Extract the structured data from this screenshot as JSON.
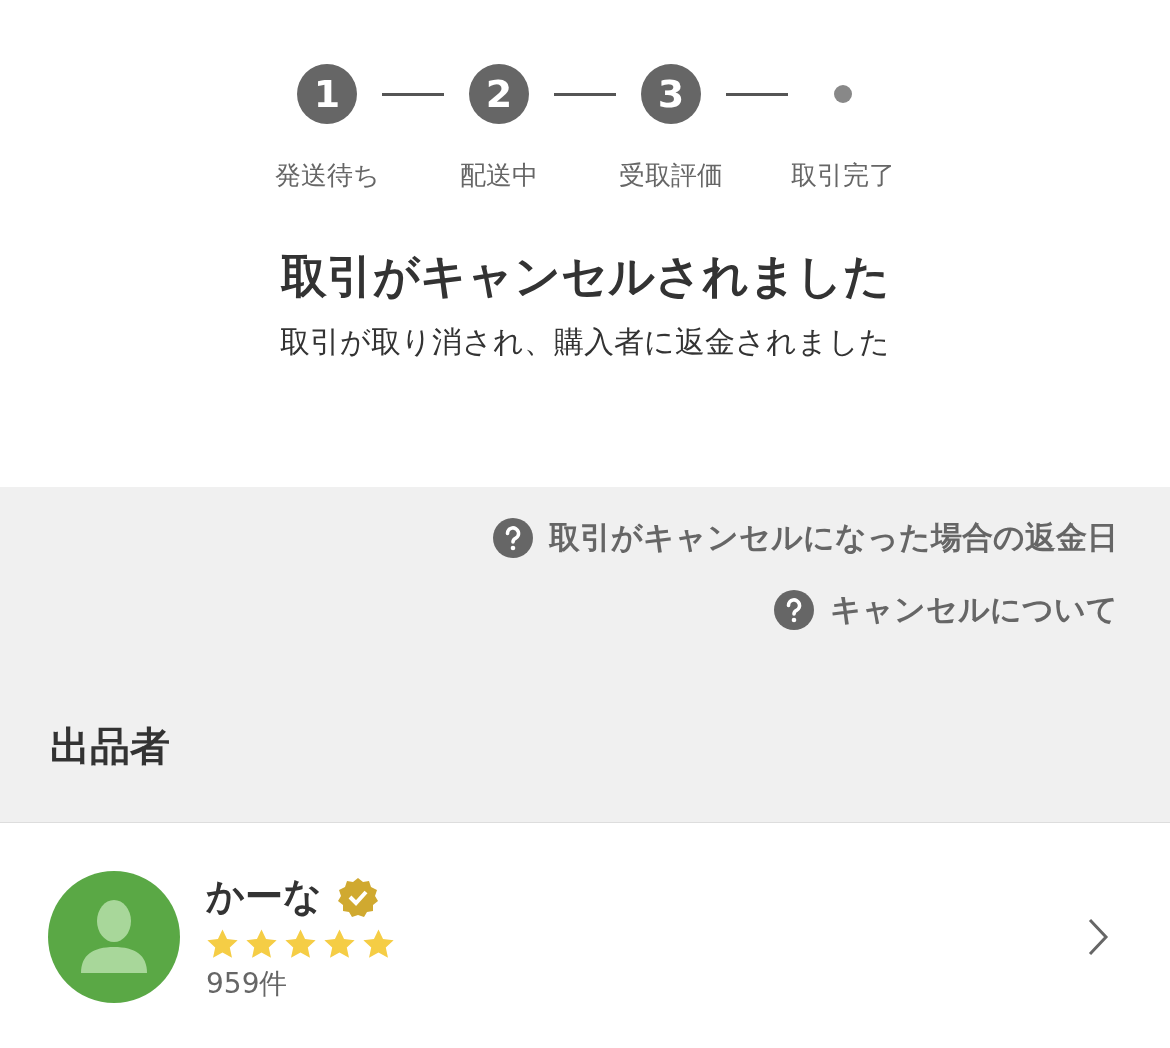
{
  "steps": [
    {
      "kind": "numbered",
      "number": "1",
      "label": "発送待ち"
    },
    {
      "kind": "numbered",
      "number": "2",
      "label": "配送中"
    },
    {
      "kind": "numbered",
      "number": "3",
      "label": "受取評価"
    },
    {
      "kind": "dot",
      "label": "取引完了"
    }
  ],
  "status": {
    "title": "取引がキャンセルされました",
    "message": "取引が取り消され、購入者に返金されました"
  },
  "help_links": [
    {
      "label": "取引がキャンセルになった場合の返金日"
    },
    {
      "label": "キャンセルについて"
    }
  ],
  "seller_section": {
    "heading": "出品者"
  },
  "seller": {
    "name": "かーな",
    "verified": true,
    "stars": 5,
    "count": "959件"
  }
}
